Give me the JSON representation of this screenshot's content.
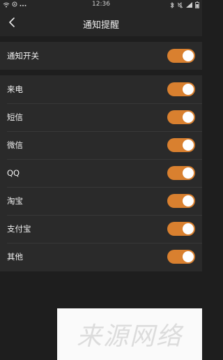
{
  "status_bar": {
    "time": "12:36",
    "left_icons": [
      "wifi-icon",
      "location-icon",
      "more-dots-icon"
    ],
    "right_icons": [
      "bluetooth-icon",
      "mute-icon",
      "signal-icon",
      "battery-icon"
    ]
  },
  "header": {
    "back_icon": "chevron-left-icon",
    "title": "通知提醒"
  },
  "master": {
    "label": "通知开关",
    "enabled": true
  },
  "apps": [
    {
      "label": "来电",
      "enabled": true
    },
    {
      "label": "短信",
      "enabled": true
    },
    {
      "label": "微信",
      "enabled": true
    },
    {
      "label": "QQ",
      "enabled": true
    },
    {
      "label": "淘宝",
      "enabled": true
    },
    {
      "label": "支付宝",
      "enabled": true
    },
    {
      "label": "其他",
      "enabled": true
    }
  ],
  "watermark": {
    "text": "来源网络"
  },
  "colors": {
    "background": "#1e1e1e",
    "panel": "#2a2a2a",
    "header": "#262626",
    "toggle_on": "#d9802f",
    "text": "#f2f2f2"
  }
}
